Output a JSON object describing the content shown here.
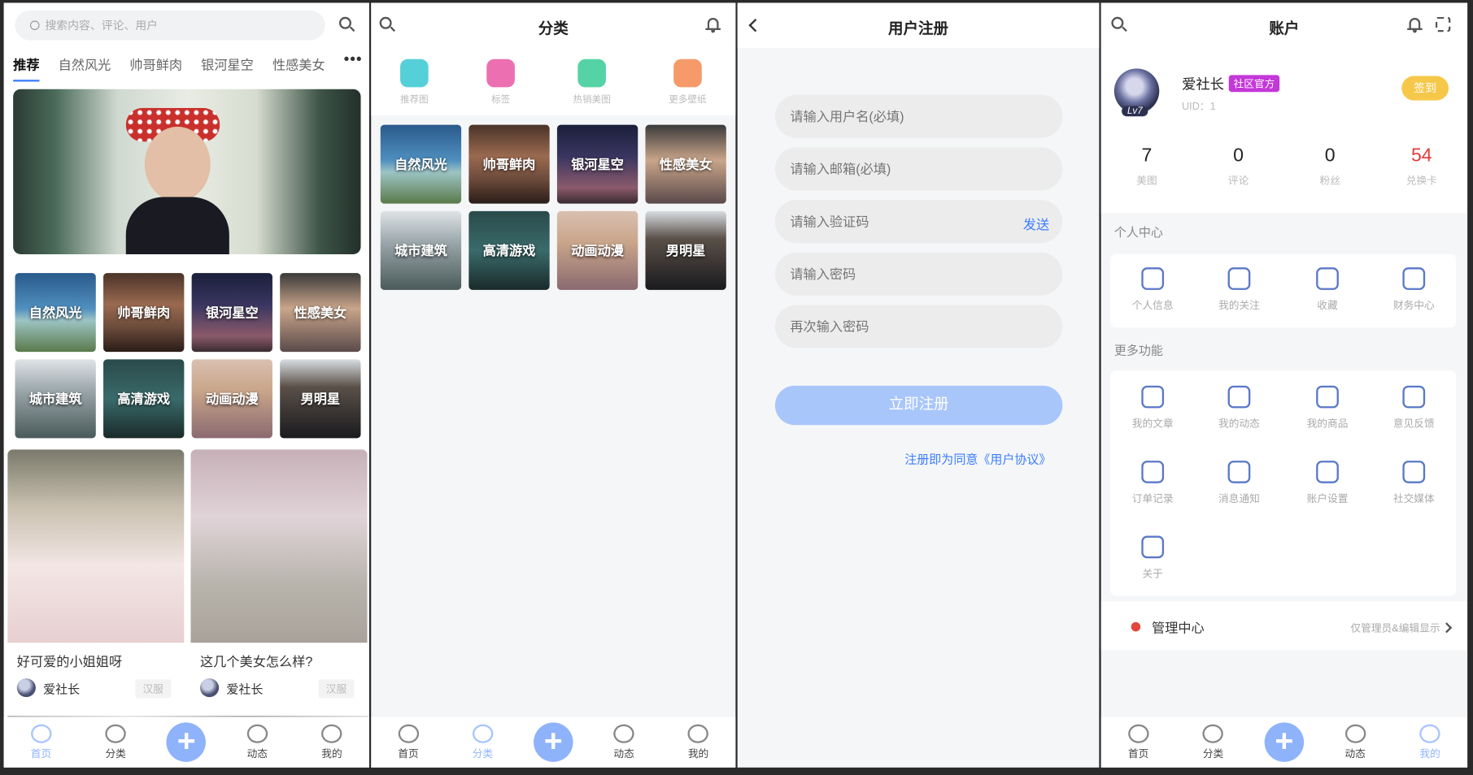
{
  "home": {
    "search_placeholder": "搜索内容、评论、用户",
    "tabs": [
      "推荐",
      "自然风光",
      "帅哥鲜肉",
      "银河星空",
      "性感美女"
    ],
    "more_label": "•••",
    "categories": [
      "自然风光",
      "帅哥鲜肉",
      "银河星空",
      "性感美女",
      "城市建筑",
      "高清游戏",
      "动画动漫",
      "男明星"
    ],
    "posts": [
      {
        "title": "好可爱的小姐姐呀",
        "author": "爱社长",
        "tag": "汉服"
      },
      {
        "title": "这几个美女怎么样?",
        "author": "爱社长",
        "tag": "汉服"
      }
    ]
  },
  "category": {
    "title": "分类",
    "quick": [
      "推荐图",
      "标签",
      "热销美图",
      "更多壁纸"
    ],
    "quick_colors": [
      "#56d0d8",
      "#ec6fb1",
      "#55d3a6",
      "#f69a6a"
    ],
    "tiles": [
      "自然风光",
      "帅哥鲜肉",
      "银河星空",
      "性感美女",
      "城市建筑",
      "高清游戏",
      "动画动漫",
      "男明星"
    ]
  },
  "register": {
    "title": "用户注册",
    "username_placeholder": "请输入用户名(必填)",
    "email_placeholder": "请输入邮箱(必填)",
    "code_placeholder": "请输入验证码",
    "send_label": "发送",
    "password_placeholder": "请输入密码",
    "password2_placeholder": "再次输入密码",
    "submit_label": "立即注册",
    "agree_text": "注册即为同意《用户协议》"
  },
  "account": {
    "title": "账户",
    "username": "爱社长",
    "badge": "社区官方",
    "uid": "UID：1",
    "level": "Lv7",
    "sign_label": "签到",
    "stats": [
      {
        "value": "7",
        "label": "美图"
      },
      {
        "value": "0",
        "label": "评论"
      },
      {
        "value": "0",
        "label": "粉丝"
      },
      {
        "value": "54",
        "label": "兑换卡"
      }
    ],
    "stat_highlight_color": "#e23b3b",
    "personal_title": "个人中心",
    "personal_items": [
      "个人信息",
      "我的关注",
      "收藏",
      "财务中心"
    ],
    "more_title": "更多功能",
    "more_items": [
      "我的文章",
      "我的动态",
      "我的商品",
      "意见反馈",
      "订单记录",
      "消息通知",
      "账户设置",
      "社交媒体",
      "关于"
    ],
    "admin_label": "管理中心",
    "admin_note": "仅管理员&编辑显示"
  },
  "nav": {
    "home": "首页",
    "category": "分类",
    "plus": "+",
    "dynamic": "动态",
    "mine": "我的"
  }
}
